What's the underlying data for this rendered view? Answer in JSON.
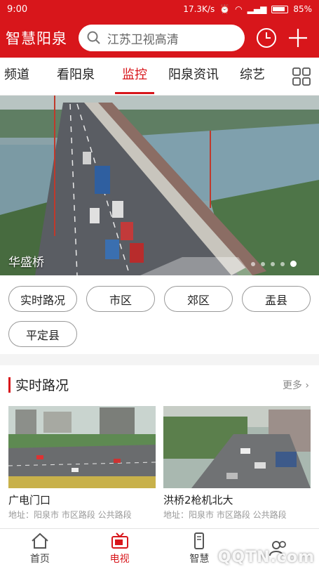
{
  "status_bar": {
    "time": "9:00",
    "net_speed": "17.3K/s",
    "battery": "85%"
  },
  "header": {
    "brand": "智慧阳泉",
    "search_placeholder": "江苏卫视高清"
  },
  "channels": [
    {
      "label": "频道",
      "active": false
    },
    {
      "label": "看阳泉",
      "active": false
    },
    {
      "label": "监控",
      "active": true
    },
    {
      "label": "阳泉资讯",
      "active": false
    },
    {
      "label": "综艺",
      "active": false
    }
  ],
  "banner": {
    "caption": "华盛桥",
    "pages": 5,
    "active_page": 5
  },
  "filters": [
    "实时路况",
    "市区",
    "郊区",
    "盂县",
    "平定县"
  ],
  "section": {
    "title": "实时路况",
    "more": "更多",
    "cards": [
      {
        "title": "广电门口",
        "address": "地址：阳泉市 市区路段 公共路段"
      },
      {
        "title": "洪桥2枪机北大",
        "address": "地址：阳泉市 市区路段 公共路段"
      }
    ]
  },
  "tabs": [
    {
      "label": "首页",
      "icon": "home-icon",
      "active": false
    },
    {
      "label": "电视",
      "icon": "tv-icon",
      "active": true
    },
    {
      "label": "智慧",
      "icon": "phone-icon",
      "active": false
    },
    {
      "label": "",
      "icon": "community-icon",
      "active": false
    }
  ],
  "watermark": "QQTN.com",
  "colors": {
    "brand_red": "#d8161b"
  }
}
